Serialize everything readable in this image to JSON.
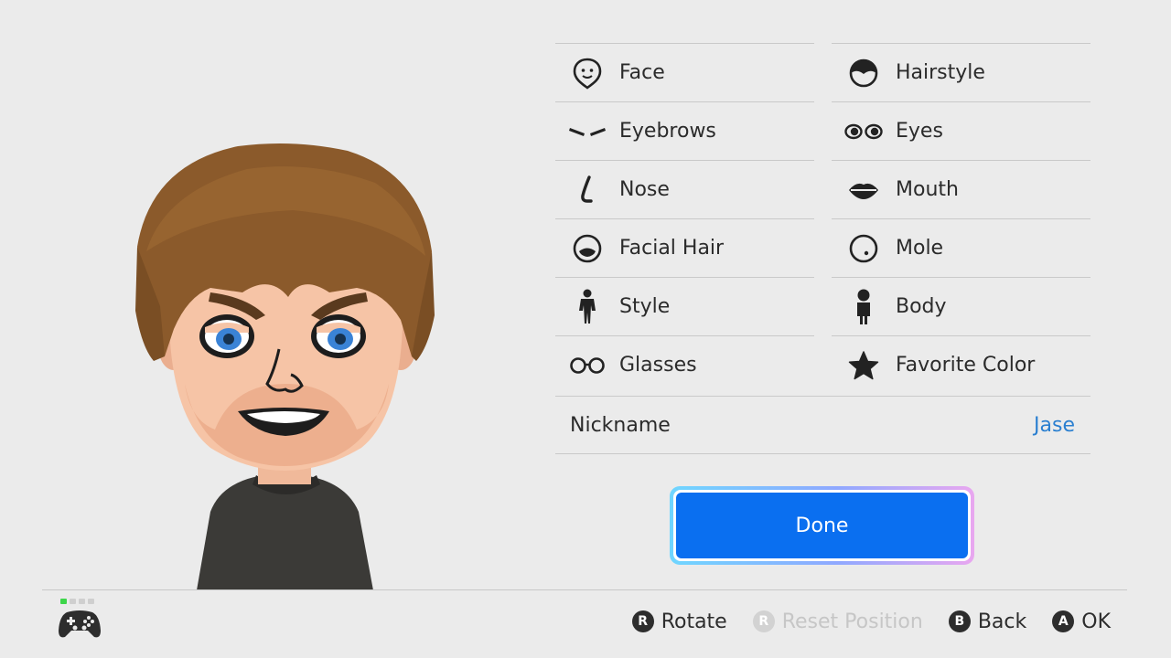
{
  "menu": {
    "left": [
      {
        "label": "Face",
        "icon": "face-icon"
      },
      {
        "label": "Eyebrows",
        "icon": "eyebrows-icon"
      },
      {
        "label": "Nose",
        "icon": "nose-icon"
      },
      {
        "label": "Facial Hair",
        "icon": "facial-hair-icon"
      },
      {
        "label": "Style",
        "icon": "style-icon"
      },
      {
        "label": "Glasses",
        "icon": "glasses-icon"
      }
    ],
    "right": [
      {
        "label": "Hairstyle",
        "icon": "hairstyle-icon"
      },
      {
        "label": "Eyes",
        "icon": "eyes-icon"
      },
      {
        "label": "Mouth",
        "icon": "mouth-icon"
      },
      {
        "label": "Mole",
        "icon": "mole-icon"
      },
      {
        "label": "Body",
        "icon": "body-icon"
      },
      {
        "label": "Favorite Color",
        "icon": "star-icon"
      }
    ]
  },
  "nickname": {
    "label": "Nickname",
    "value": "Jase"
  },
  "done": {
    "label": "Done"
  },
  "footer": {
    "rotate": {
      "button": "R",
      "label": "Rotate"
    },
    "reset": {
      "button": "R",
      "label": "Reset Position"
    },
    "back": {
      "button": "B",
      "label": "Back"
    },
    "ok": {
      "button": "A",
      "label": "OK"
    }
  },
  "colors": {
    "accent": "#0a6ff0",
    "nickname_value": "#2a7fd0",
    "controller_active": "#3dd64a"
  }
}
